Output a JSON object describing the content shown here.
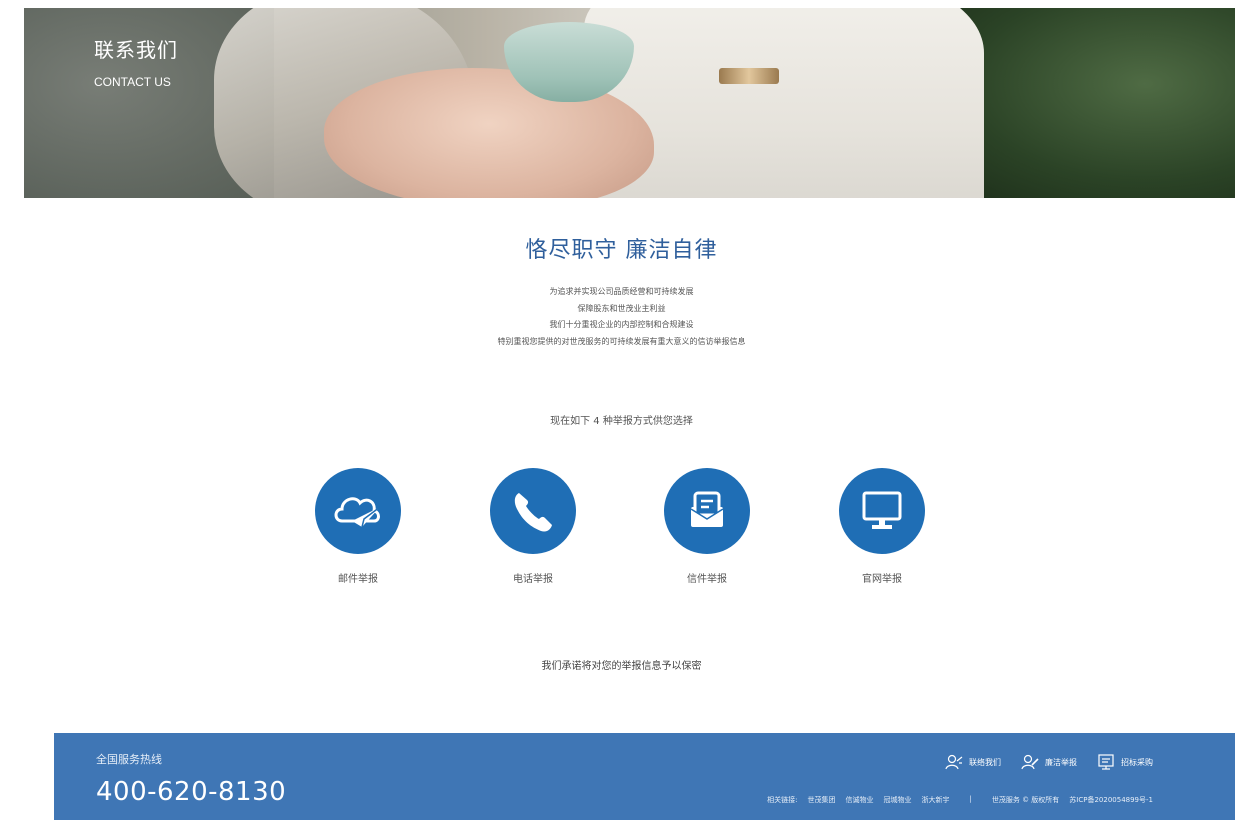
{
  "banner": {
    "title": "联系我们",
    "subtitle": "CONTACT US"
  },
  "main": {
    "title": "恪尽职守 廉洁自律",
    "intro": [
      "为追求并实现公司品质经营和可持续发展",
      "保障股东和世茂业主利益",
      "我们十分重视企业的内部控制和合规建设",
      "特别重视您提供的对世茂服务的可持续发展有重大意义的信访举报信息"
    ],
    "choose_text": "现在如下 4 种举报方式供您选择",
    "methods": [
      {
        "label": "邮件举报",
        "icon": "cloud-send-icon"
      },
      {
        "label": "电话举报",
        "icon": "phone-icon"
      },
      {
        "label": "信件举报",
        "icon": "letter-icon"
      },
      {
        "label": "官网举报",
        "icon": "monitor-icon"
      }
    ],
    "promise": "我们承诺将对您的举报信息予以保密"
  },
  "footer": {
    "hotline_label": "全国服务热线",
    "hotline_number": "400-620-8130",
    "nav": [
      {
        "label": "联络我们",
        "icon": "contact-icon"
      },
      {
        "label": "廉洁举报",
        "icon": "report-icon"
      },
      {
        "label": "招标采购",
        "icon": "procurement-icon"
      }
    ],
    "links_label": "相关链接:",
    "links": [
      "世茂集团",
      "信诚物业",
      "冠城物业",
      "浙大新宇"
    ],
    "separator": "|",
    "copyright": "世茂服务 © 版权所有",
    "icp": "苏ICP备2020054899号-1"
  },
  "colors": {
    "accent": "#1f6eb5",
    "footer_bg": "#3f76b5",
    "title": "#2f5f9c"
  }
}
